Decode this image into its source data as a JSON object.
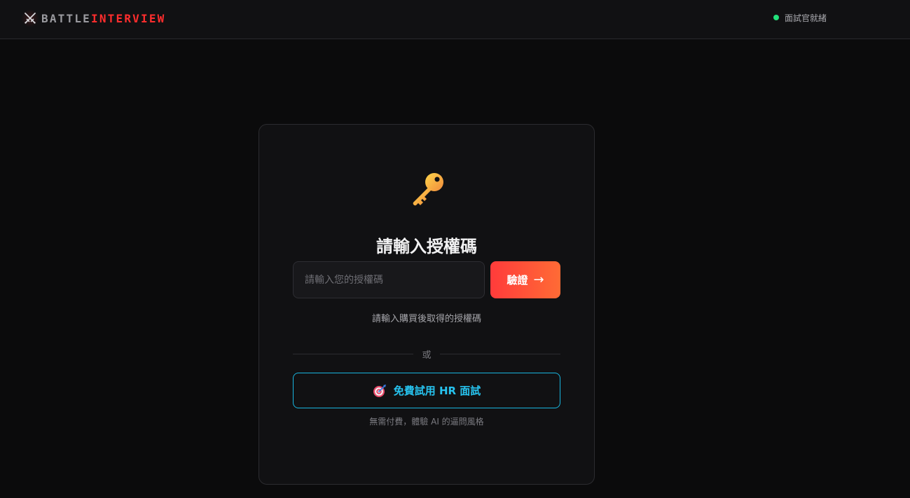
{
  "header": {
    "brand_part1": "BATTLE",
    "brand_part2": "INTERVIEW",
    "brand_icon": "crossed-swords-icon",
    "status_text": "面試官就緒",
    "status_color": "#22e07a",
    "accent_color": "#ff2d2d"
  },
  "card": {
    "icon": "key-icon",
    "title": "請輸入授權碼",
    "input_placeholder": "請輸入您的授權碼",
    "input_value": "",
    "verify_label": "驗證",
    "verify_arrow": "→",
    "hint": "請輸入購買後取得的授權碼",
    "divider_text": "或",
    "trial_icon": "target-icon",
    "trial_label": "免費試用 HR 面試",
    "trial_subtext": "無需付費，體驗 AI 的逼問風格"
  }
}
